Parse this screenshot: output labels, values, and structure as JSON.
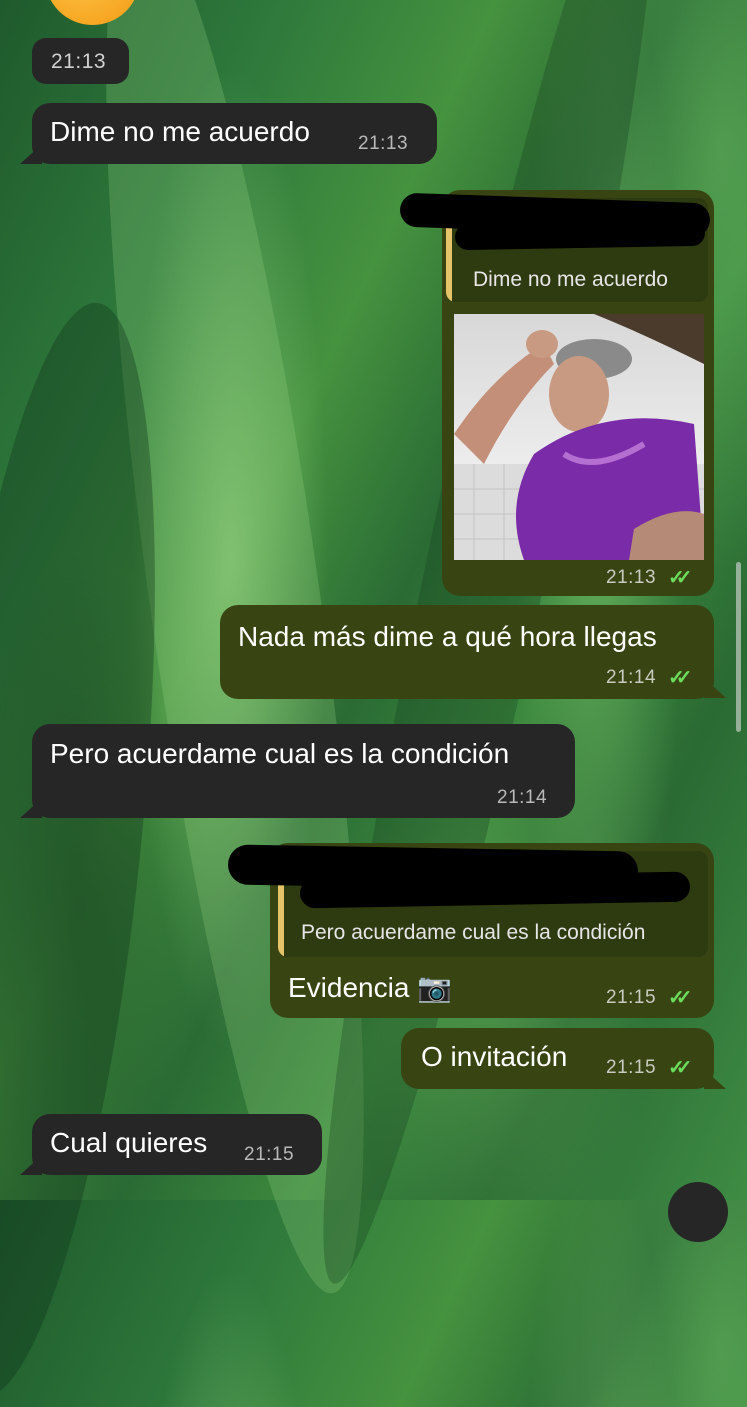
{
  "chat": {
    "date_chip": "21:13",
    "messages": [
      {
        "dir": "in",
        "text": "Dime no me acuerdo",
        "time": "21:13"
      },
      {
        "dir": "out",
        "quote_text": "Dime no me acuerdo",
        "image": "woman-crying-meme",
        "time": "21:13",
        "status": "read"
      },
      {
        "dir": "out",
        "text": "Nada más dime a qué hora llegas",
        "time": "21:14",
        "status": "read"
      },
      {
        "dir": "in",
        "text": "Pero acuerdame cual es la condición",
        "time": "21:14"
      },
      {
        "dir": "out",
        "quote_text": "Pero acuerdame cual es la condición",
        "text": "Evidencia 📷",
        "time": "21:15",
        "status": "read"
      },
      {
        "dir": "out",
        "text": "O invitación",
        "time": "21:15",
        "status": "read"
      },
      {
        "dir": "in",
        "text": "Cual quieres",
        "time": "21:15"
      }
    ]
  },
  "colors": {
    "incoming_bubble": "#262626",
    "outgoing_bubble": "#384412",
    "read_check": "#6bdc5b",
    "quote_bar": "#e6c46a"
  }
}
